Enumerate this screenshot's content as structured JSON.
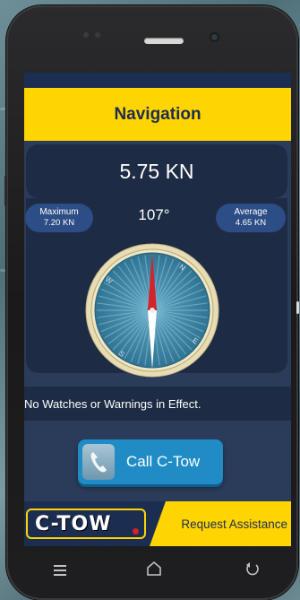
{
  "header": {
    "title": "Navigation"
  },
  "speed": {
    "current": "5.75 KN"
  },
  "stats": {
    "max_label": "Maximum",
    "max_value": "7.20 KN",
    "avg_label": "Average",
    "avg_value": "4.65 KN"
  },
  "compass": {
    "heading": "107°",
    "heading_degrees": 107,
    "cardinals": {
      "east": "E",
      "south": "S",
      "west": "W",
      "north": "N"
    }
  },
  "alerts": {
    "message": "No Watches or Warnings in Effect."
  },
  "call_button": {
    "label": "Call C-Tow",
    "icon": "phone-icon"
  },
  "footer": {
    "brand": "C-TOW",
    "request_label": "Request Assistance"
  },
  "navbar": {
    "icons": [
      "menu-icon",
      "home-icon",
      "back-icon"
    ]
  },
  "colors": {
    "header_yellow": "#ffd400",
    "panel_navy": "#1e2b44",
    "pill_blue": "#2c4d85",
    "call_blue": "#1f8cc6"
  }
}
